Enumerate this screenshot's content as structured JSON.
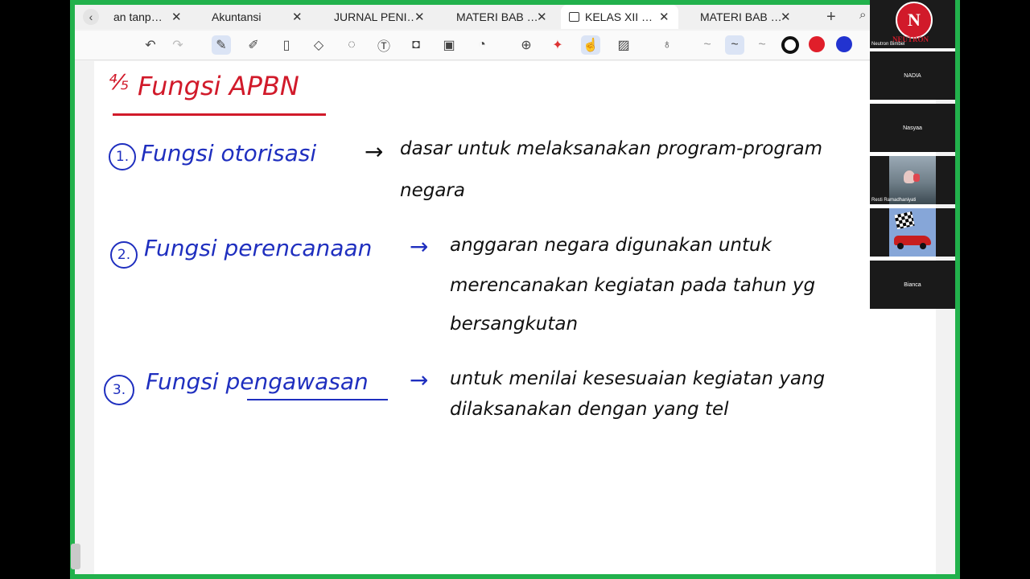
{
  "tabs": [
    {
      "label": "an tanp…",
      "active": false
    },
    {
      "label": "Akuntansi",
      "active": false
    },
    {
      "label": "JURNAL PENI…",
      "active": false
    },
    {
      "label": "MATERI BAB …",
      "active": false
    },
    {
      "label": "KELAS XII …",
      "active": true
    },
    {
      "label": "MATERI BAB …",
      "active": false
    }
  ],
  "tab_close_glyph": "✕",
  "toolbar": {
    "tools": [
      "undo-icon",
      "redo-icon",
      "pen-icon",
      "pencil-icon",
      "highlighter-icon",
      "eraser-icon",
      "lasso-icon",
      "text-icon",
      "shapes-icon",
      "image-icon",
      "sticker-icon",
      "zoom-icon",
      "laser-icon",
      "touch-icon",
      "grid-icon",
      "mic-icon"
    ],
    "selected": [
      "pen-icon",
      "touch-icon"
    ],
    "colors": [
      "#111111",
      "#e01e2a",
      "#2233d0"
    ]
  },
  "note": {
    "title_mark": "⅘",
    "title": "Fungsi   APBN",
    "items": [
      {
        "num": "1.",
        "name": "Fungsi   otorisasi",
        "arrow": "→",
        "lines": [
          "dasar   untuk   melaksanakan   program-program",
          "negara"
        ]
      },
      {
        "num": "2.",
        "name": "Fungsi   perencanaan",
        "arrow": "→",
        "lines": [
          "anggaran   negara   digunakan   untuk",
          "merencanakan   kegiatan   pada   tahun   yg",
          "bersangkutan"
        ]
      },
      {
        "num": "3.",
        "name": "Fungsi   pengawasan",
        "arrow": "→",
        "lines": [
          "untuk   menilai   kesesuaian   kegiatan   yang",
          "dilaksanakan   dengan   yang   tel"
        ]
      }
    ]
  },
  "participants": [
    {
      "name": "Neutron Bimbel",
      "kind": "logo",
      "logo_letter": "N",
      "logo_text": "NEUTRON"
    },
    {
      "name": "NADIA",
      "kind": "text"
    },
    {
      "name": "Nasyaa",
      "kind": "text"
    },
    {
      "name": "Resti Ramadhaniyati",
      "kind": "photo"
    },
    {
      "name": "",
      "kind": "photo"
    },
    {
      "name": "Bianca",
      "kind": "text"
    }
  ]
}
